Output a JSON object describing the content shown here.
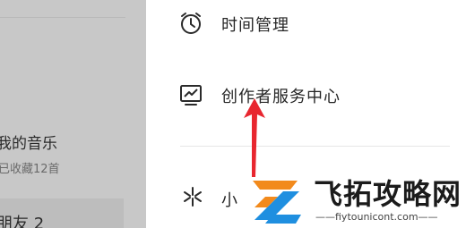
{
  "left_panel": {
    "my_music": "我的音乐",
    "fav_count": "已收藏12首",
    "friends": "朋友 2"
  },
  "menu": {
    "items": [
      {
        "label": "时间管理",
        "icon": "alarm-clock-icon"
      },
      {
        "label": "创作者服务中心",
        "icon": "trend-chart-icon"
      },
      {
        "label": "小",
        "icon": "sparkle-icon"
      }
    ]
  },
  "watermark": {
    "title": "飞拓攻略网",
    "url": "——fiytounicont.com——"
  },
  "colors": {
    "arrow": "#e8262f",
    "logo_orange": "#f28a1c",
    "logo_blue": "#1f8fe0"
  }
}
